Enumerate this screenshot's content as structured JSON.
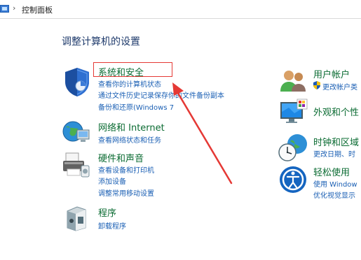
{
  "address_bar": {
    "separator": "›",
    "crumb": "控制面板"
  },
  "main": {
    "title": "调整计算机的设置"
  },
  "left_categories": [
    {
      "title": "系统和安全",
      "links": [
        "查看你的计算机状态",
        "通过文件历史记录保存你的文件备份副本",
        "备份和还原(Windows 7"
      ]
    },
    {
      "title": "网络和 Internet",
      "links": [
        "查看网络状态和任务"
      ]
    },
    {
      "title": "硬件和声音",
      "links": [
        "查看设备和打印机",
        "添加设备",
        "调整常用移动设置"
      ]
    },
    {
      "title": "程序",
      "links": [
        "卸载程序"
      ]
    }
  ],
  "right_categories": [
    {
      "title": "用户帐户",
      "links": [
        "更改帐户类"
      ]
    },
    {
      "title": "外观和个性",
      "links": []
    },
    {
      "title": "时钟和区域",
      "links": [
        "更改日期、时"
      ]
    },
    {
      "title": "轻松使用",
      "links": [
        "使用 Window",
        "优化视觉显示"
      ]
    }
  ],
  "colors": {
    "category_title": "#0a6b32",
    "link": "#1a5fb4",
    "annotation": "#e53935"
  }
}
